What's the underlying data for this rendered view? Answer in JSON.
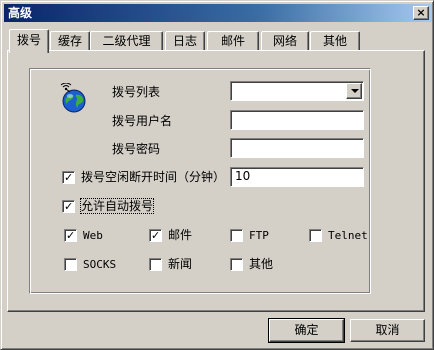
{
  "window": {
    "title": "高级",
    "close_label": "×"
  },
  "tabs": [
    {
      "label": "拨号",
      "active": true
    },
    {
      "label": "缓存"
    },
    {
      "label": "二级代理"
    },
    {
      "label": "日志"
    },
    {
      "label": "邮件"
    },
    {
      "label": "网络"
    },
    {
      "label": "其他"
    }
  ],
  "dial": {
    "list_label": "拨号列表",
    "list_value": "",
    "username_label": "拨号用户名",
    "username_value": "",
    "password_label": "拨号密码",
    "password_value": "",
    "idle_label": "拨号空闲断开时间（分钟）",
    "idle_checked": true,
    "idle_value": "10",
    "auto_label": "允许自动拨号",
    "auto_checked": true
  },
  "services": [
    {
      "label": "Web",
      "checked": true
    },
    {
      "label": "邮件",
      "checked": true
    },
    {
      "label": "FTP",
      "checked": false
    },
    {
      "label": "Telnet",
      "checked": false
    },
    {
      "label": "SOCKS",
      "checked": false
    },
    {
      "label": "新闻",
      "checked": false
    },
    {
      "label": "其他",
      "checked": false
    }
  ],
  "buttons": {
    "ok": "确定",
    "cancel": "取消"
  },
  "icons": {
    "dial": "globe-network-icon",
    "close": "close-icon",
    "dropdown": "chevron-down-icon"
  }
}
